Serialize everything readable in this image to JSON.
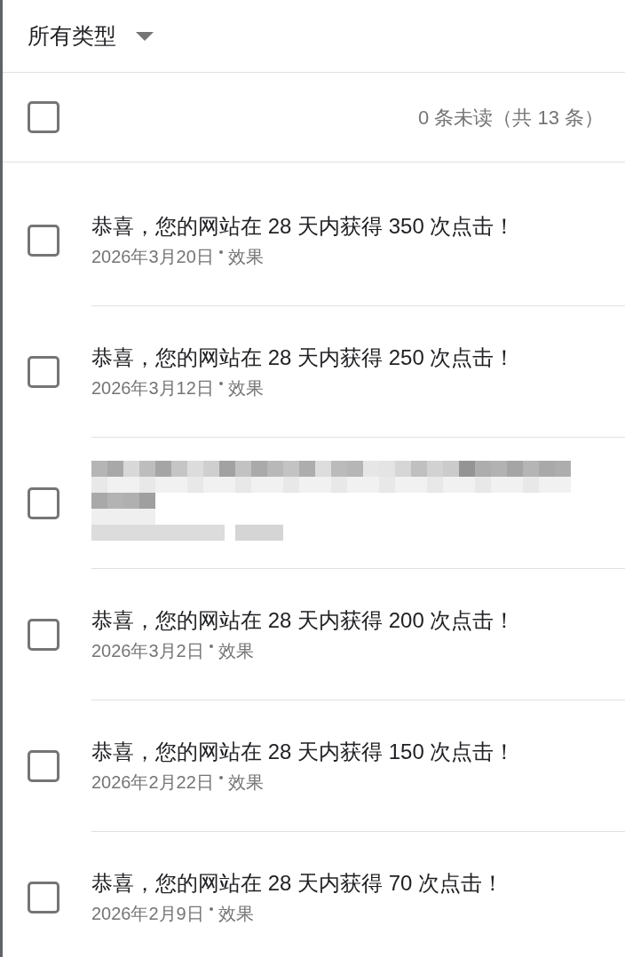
{
  "filter": {
    "label": "所有类型"
  },
  "toolbar": {
    "select_all_checked": false,
    "summary": "0 条未读（共 13 条）"
  },
  "messages": [
    {
      "kind": "message",
      "title": "恭喜，您的网站在 28 天内获得 350 次点击！",
      "date": "2026年3月20日",
      "category": "效果",
      "checked": false
    },
    {
      "kind": "message",
      "title": "恭喜，您的网站在 28 天内获得 250 次点击！",
      "date": "2026年3月12日",
      "category": "效果",
      "checked": false
    },
    {
      "kind": "redacted",
      "checked": false
    },
    {
      "kind": "message",
      "title": "恭喜，您的网站在 28 天内获得 200 次点击！",
      "date": "2026年3月2日",
      "category": "效果",
      "checked": false
    },
    {
      "kind": "message",
      "title": "恭喜，您的网站在 28 天内获得 150 次点击！",
      "date": "2026年2月22日",
      "category": "效果",
      "checked": false
    },
    {
      "kind": "message",
      "title": "恭喜，您的网站在 28 天内获得 70 次点击！",
      "date": "2026年2月9日",
      "category": "效果",
      "checked": false
    }
  ]
}
